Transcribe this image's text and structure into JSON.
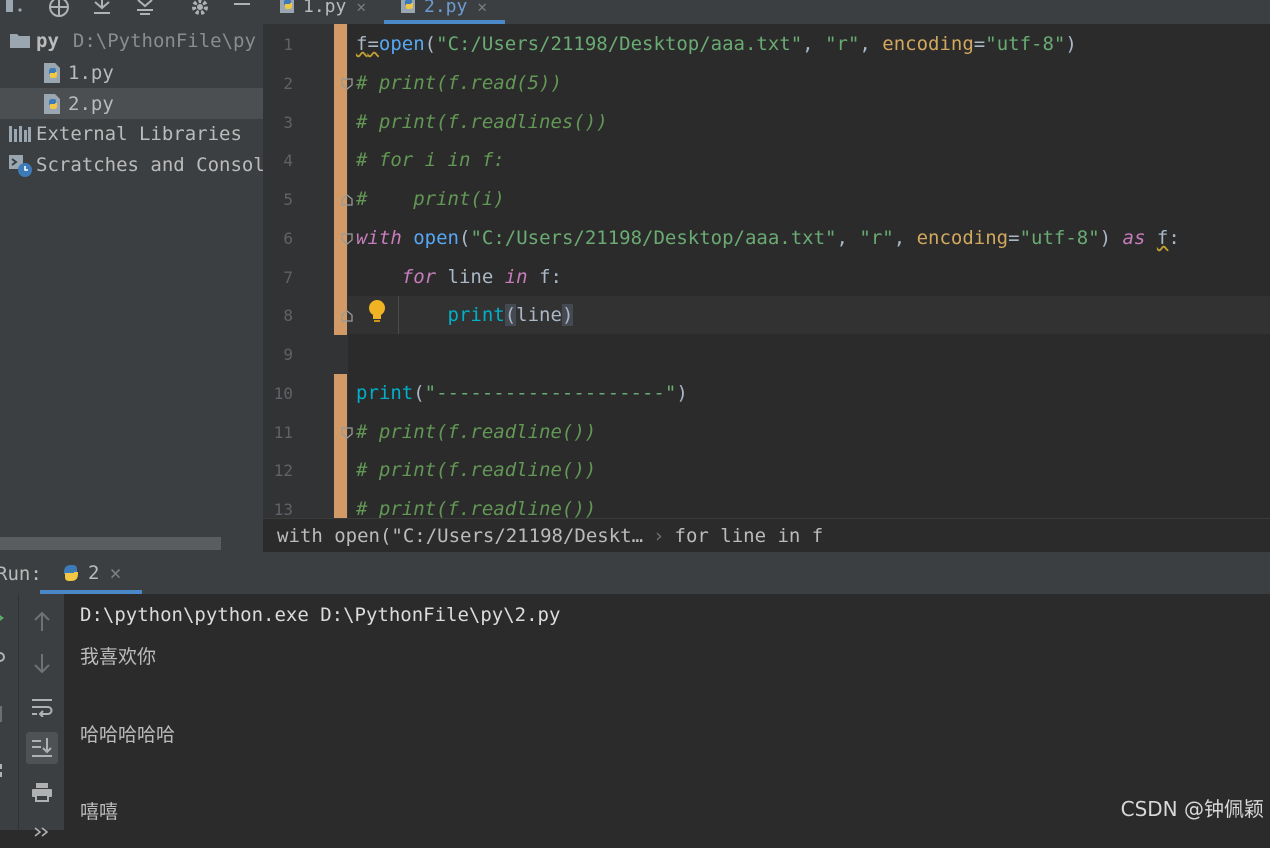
{
  "project": {
    "toolbar_icons": [
      "collapse-dropdown-icon",
      "locate-icon",
      "expand-all-icon",
      "collapse-all-icon",
      "gear-icon",
      "minimize-icon"
    ],
    "root_name": "py",
    "root_path": "D:\\PythonFile\\py",
    "files": [
      {
        "label": "1.py",
        "icon": "python-file-icon",
        "selected": false
      },
      {
        "label": "2.py",
        "icon": "python-file-icon",
        "selected": true
      }
    ],
    "external_libraries": "External Libraries",
    "scratches": "Scratches and Consoles"
  },
  "tabs": [
    {
      "label": "1.py",
      "active": false
    },
    {
      "label": "2.py",
      "active": true
    }
  ],
  "editor": {
    "line_numbers": [
      "1",
      "2",
      "3",
      "4",
      "5",
      "6",
      "7",
      "8",
      "9",
      "10",
      "11",
      "12",
      "13"
    ],
    "lines": {
      "l1": {
        "a": "f",
        "b": "=",
        "c": "open",
        "d": "(",
        "e": "\"C:/Users/21198/Desktop/aaa.txt\"",
        "f": ", ",
        "g": "\"r\"",
        "h": ", ",
        "i": "encoding",
        "j": "=",
        "k": "\"utf-8\"",
        "l": ")"
      },
      "l2": "# print(f.read(5))",
      "l3": "# print(f.readlines())",
      "l4": "# for i in f:",
      "l5": "#    print(i)",
      "l6": {
        "a": "with",
        "b": " ",
        "c": "open",
        "d": "(",
        "e": "\"C:/Users/21198/Desktop/aaa.txt\"",
        "f": ", ",
        "g": "\"r\"",
        "h": ", ",
        "i": "encoding",
        "j": "=",
        "k": "\"utf-8\"",
        "l": ") ",
        "m": "as",
        "n": " ",
        "o": "f",
        "p": ":"
      },
      "l7": {
        "indent": "    ",
        "a": "for",
        "b": " line ",
        "c": "in",
        "d": " f:"
      },
      "l8": {
        "indent": "        ",
        "a": "print",
        "b": "(",
        "c": "line",
        "d": ")"
      },
      "l10": {
        "a": "print",
        "b": "(",
        "c": "\"--------------------\"",
        "d": ")"
      },
      "l11": "# print(f.readline())",
      "l12": "# print(f.readline())",
      "l13": "# print(f.readline())"
    }
  },
  "breadcrumb": [
    "with open(\"C:/Users/21198/Deskt…",
    "for line in f"
  ],
  "breadcrumb_sep": "›",
  "run": {
    "label": "Run:",
    "tab_label": "2",
    "close": "×",
    "output": [
      "D:\\python\\python.exe D:\\PythonFile\\py\\2.py",
      "我喜欢你",
      "哈哈哈哈哈",
      "嘻嘻"
    ]
  },
  "watermark": "CSDN @钟佩颖",
  "colors": {
    "accent": "#4a88c7",
    "change_marker": "#d19a66",
    "background": "#2b2b2b",
    "panel": "#3c3f41"
  }
}
